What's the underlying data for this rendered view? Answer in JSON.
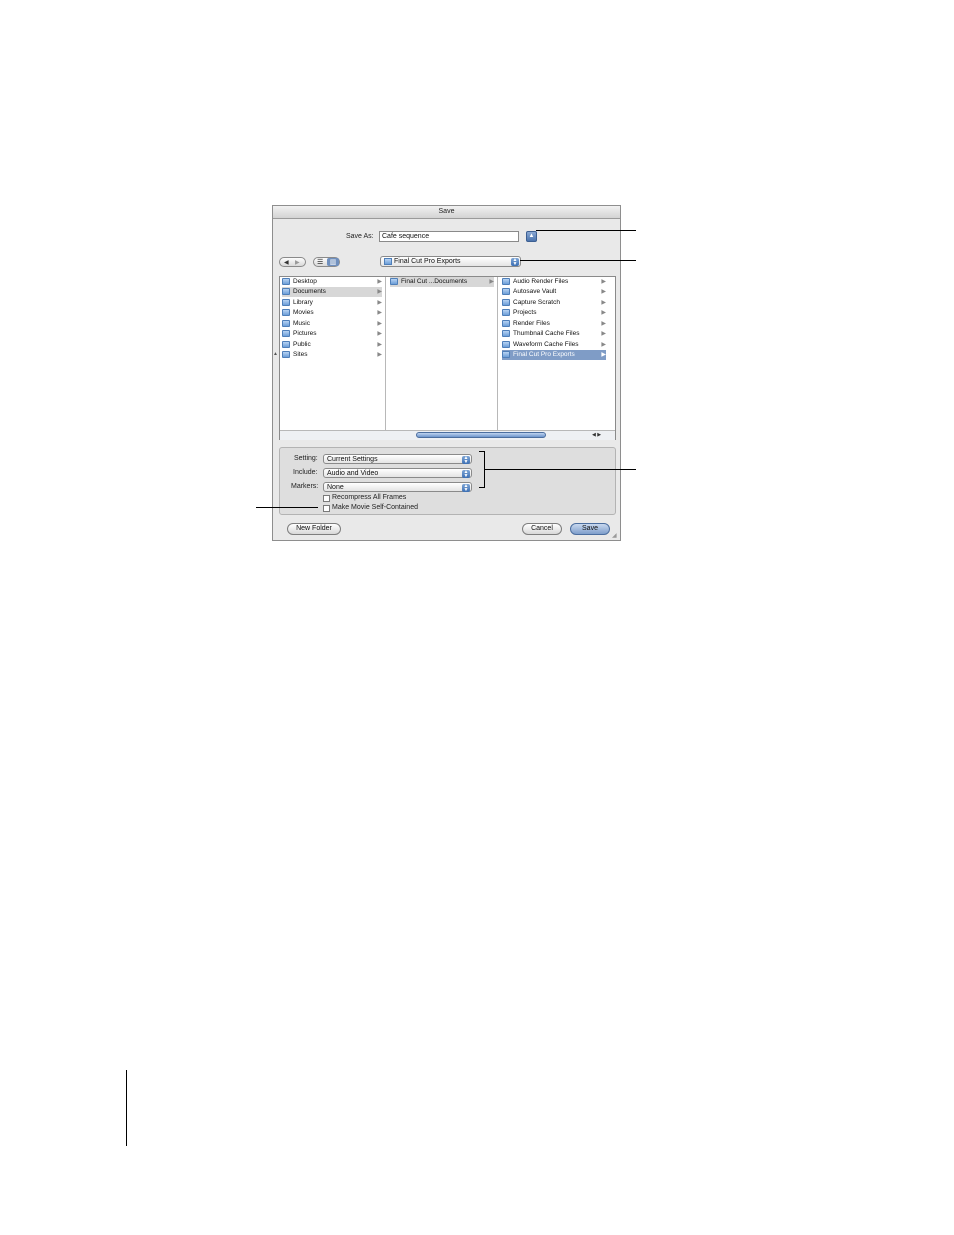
{
  "window": {
    "title": "Save"
  },
  "save_as": {
    "label": "Save As:",
    "value": "Cafe sequence"
  },
  "toolbar": {
    "back": "◀",
    "forward": "▶",
    "list_view": "☰",
    "column_view": "▥"
  },
  "location_popup": {
    "value": "Final Cut Pro Exports"
  },
  "browser": {
    "column1": [
      {
        "label": "Desktop"
      },
      {
        "label": "Documents"
      },
      {
        "label": "Library"
      },
      {
        "label": "Movies"
      },
      {
        "label": "Music"
      },
      {
        "label": "Pictures"
      },
      {
        "label": "Public"
      },
      {
        "label": "Sites"
      }
    ],
    "column2": [
      {
        "label": "Final Cut ...Documents"
      }
    ],
    "column3": [
      {
        "label": "Audio Render Files"
      },
      {
        "label": "Autosave Vault"
      },
      {
        "label": "Capture Scratch"
      },
      {
        "label": "Projects"
      },
      {
        "label": "Render Files"
      },
      {
        "label": "Thumbnail Cache Files"
      },
      {
        "label": "Waveform Cache Files"
      },
      {
        "label": "Final Cut Pro Exports"
      }
    ]
  },
  "options": {
    "setting": {
      "label": "Setting:",
      "value": "Current Settings"
    },
    "include": {
      "label": "Include:",
      "value": "Audio and Video"
    },
    "markers": {
      "label": "Markers:",
      "value": "None"
    },
    "recompress": {
      "label": "Recompress All Frames",
      "checked": false
    },
    "self_contained": {
      "label": "Make Movie Self-Contained",
      "checked": false
    }
  },
  "buttons": {
    "new_folder": "New Folder",
    "cancel": "Cancel",
    "save": "Save"
  },
  "colors": {
    "selection_blue": "#7f9cc6",
    "selection_gray": "#d7d7d7"
  }
}
